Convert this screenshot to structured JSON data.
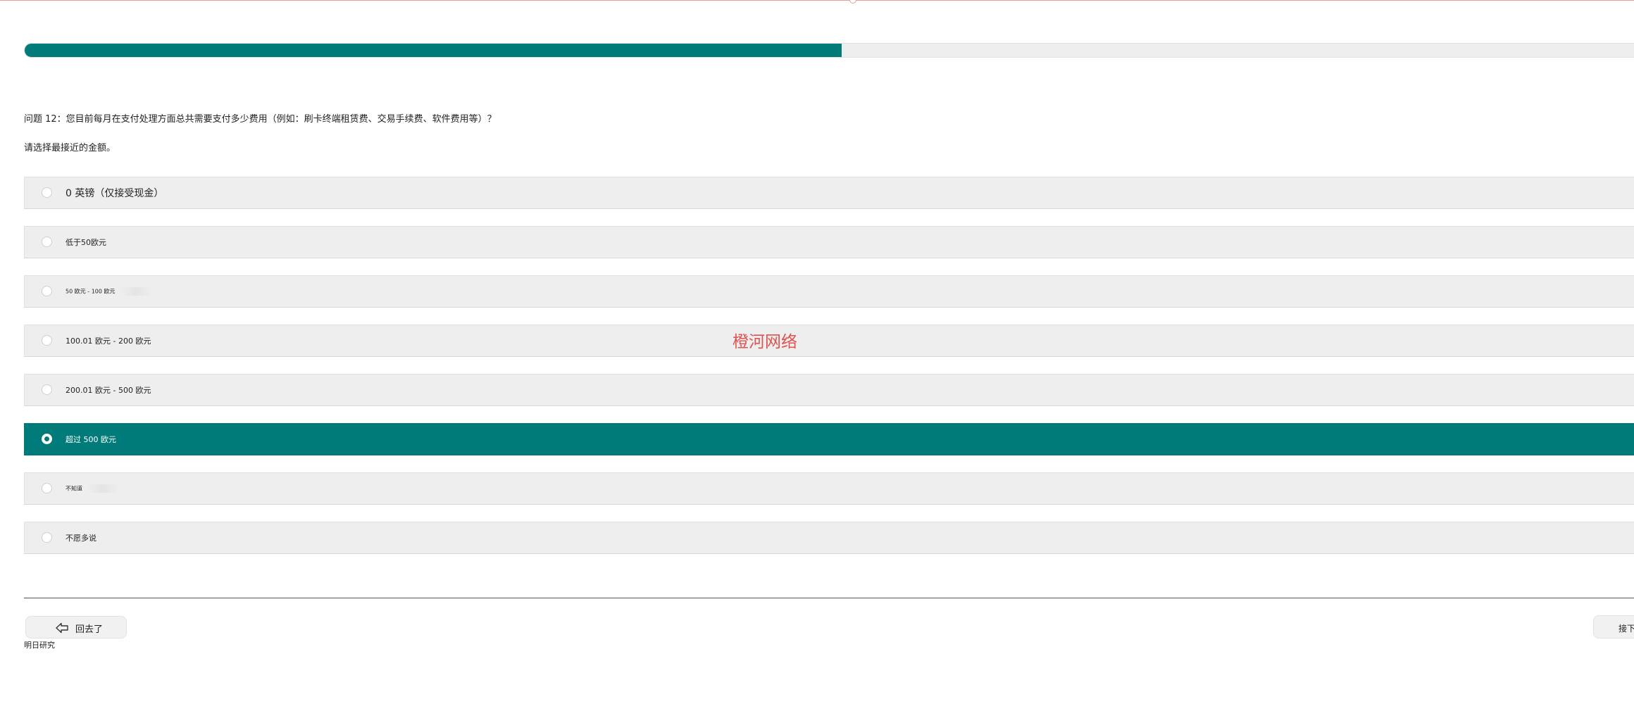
{
  "survey": {
    "progress_fraction": 0.5,
    "question": "问题 12：您目前每月在支付处理方面总共需要支付多少费用（例如：刷卡终端租赁费、交易手续费、软件费用等）？",
    "instruction": "请选择最接近的金额。",
    "options": [
      {
        "label": "0 英镑（仅接受现金）",
        "selected": false
      },
      {
        "label": "低于50欧元",
        "selected": false
      },
      {
        "label": "50 欧元 - 100 欧元",
        "selected": false
      },
      {
        "label": "100.01 欧元 - 200 欧元",
        "selected": false
      },
      {
        "label": "200.01 欧元 - 500 欧元",
        "selected": false
      },
      {
        "label": "超过 500 欧元",
        "selected": true
      },
      {
        "label": "不知道",
        "selected": false
      },
      {
        "label": "不愿多说",
        "selected": false
      }
    ]
  },
  "watermark": "橙河网络",
  "nav": {
    "back_label": "回去了",
    "next_label": "接下"
  },
  "footer": {
    "brand": "明日研究"
  },
  "colors": {
    "accent": "#007b7a",
    "option_bg": "#eeeeee",
    "watermark": "#e0514f"
  },
  "icons": {
    "back": "back-arrow-icon",
    "radio": "radio-icon"
  }
}
